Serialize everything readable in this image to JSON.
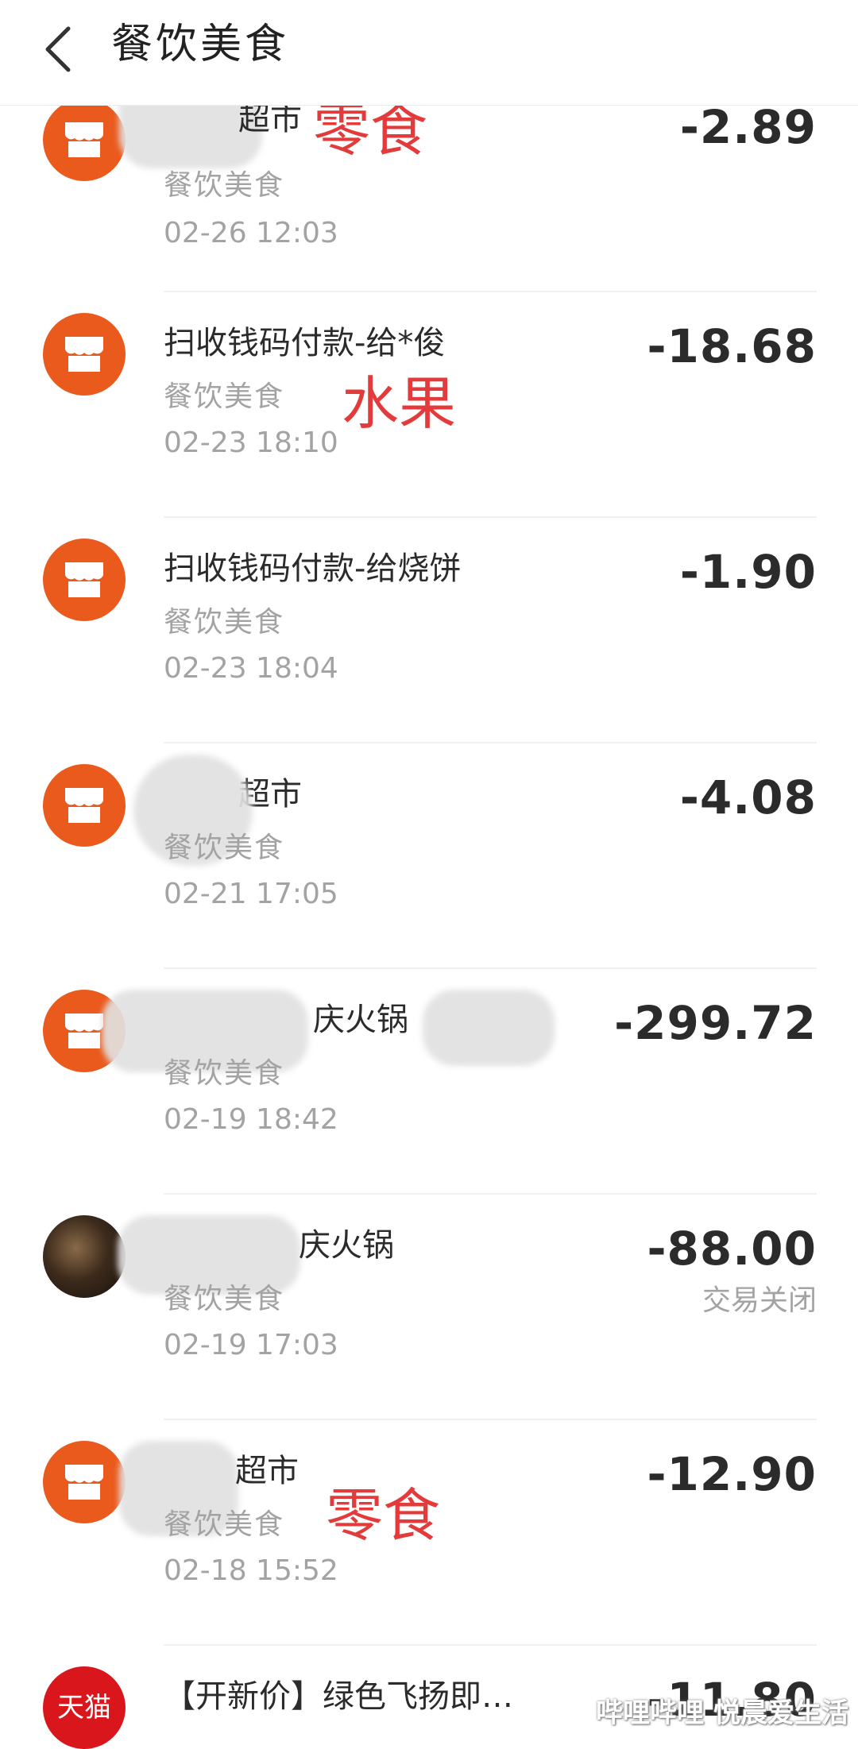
{
  "header": {
    "title": "餐饮美食"
  },
  "transactions": [
    {
      "name": "超市",
      "category": "餐饮美食",
      "time": "02-26  12:03",
      "amount": "-2.89",
      "status": "",
      "annotation": "零食"
    },
    {
      "name": "扫收钱码付款-给*俊",
      "category": "餐饮美食",
      "time": "02-23  18:10",
      "amount": "-18.68",
      "status": "",
      "annotation": "水果"
    },
    {
      "name": "扫收钱码付款-给烧饼",
      "category": "餐饮美食",
      "time": "02-23  18:04",
      "amount": "-1.90",
      "status": "",
      "annotation": ""
    },
    {
      "name": "超市",
      "category": "餐饮美食",
      "time": "02-21  17:05",
      "amount": "-4.08",
      "status": "",
      "annotation": ""
    },
    {
      "name": "庆火锅",
      "category": "餐饮美食",
      "time": "02-19  18:42",
      "amount": "-299.72",
      "status": "",
      "annotation": ""
    },
    {
      "name": "庆火锅",
      "category": "餐饮美食",
      "time": "02-19  17:03",
      "amount": "-88.00",
      "status": "交易关闭",
      "annotation": ""
    },
    {
      "name": "超市",
      "category": "餐饮美食",
      "time": "02-18  15:52",
      "amount": "-12.90",
      "status": "",
      "annotation": "零食"
    },
    {
      "name": "【开新价】绿色飞扬即…",
      "category": "",
      "time": "",
      "amount": "-11.80",
      "status": "",
      "annotation": "",
      "icon_text": "天猫"
    }
  ],
  "watermark": "哔哩哔哩 悦晨爱生活",
  "colors": {
    "accent": "#ea5a1d",
    "annotation": "#e33b3b",
    "tmall": "#d8161b"
  }
}
